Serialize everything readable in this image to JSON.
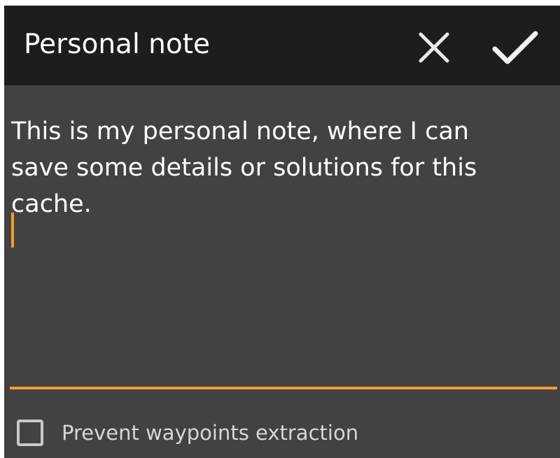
{
  "dialog": {
    "title": "Personal note",
    "actions": {
      "cancel_icon": "close-icon",
      "confirm_icon": "check-icon"
    },
    "note": {
      "value": "This is my personal note, where I can\nsave some details or solutions for this\ncache."
    },
    "option": {
      "label": "Prevent waypoints extraction",
      "checked": false
    }
  },
  "colors": {
    "toolbar_bg": "#1d1d1d",
    "dialog_bg": "#424242",
    "accent": "#f39c2b",
    "text": "#ffffff"
  }
}
